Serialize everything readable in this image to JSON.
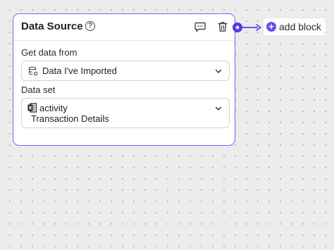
{
  "card": {
    "title": "Data Source",
    "help_icon": "?",
    "header_icons": [
      "comment-icon",
      "trash-icon"
    ]
  },
  "get_data": {
    "label": "Get data from",
    "icon": "database-icon",
    "value": "Data I've Imported"
  },
  "data_set": {
    "label": "Data set",
    "icon": "excel-file-icon",
    "value_line1": "activity",
    "value_line2": "Transaction Details"
  },
  "add_block": {
    "icon": "+",
    "label": "add block"
  },
  "colors": {
    "accent": "#6c4cf5",
    "card_border": "#7b61ff",
    "canvas": "#ececec"
  }
}
